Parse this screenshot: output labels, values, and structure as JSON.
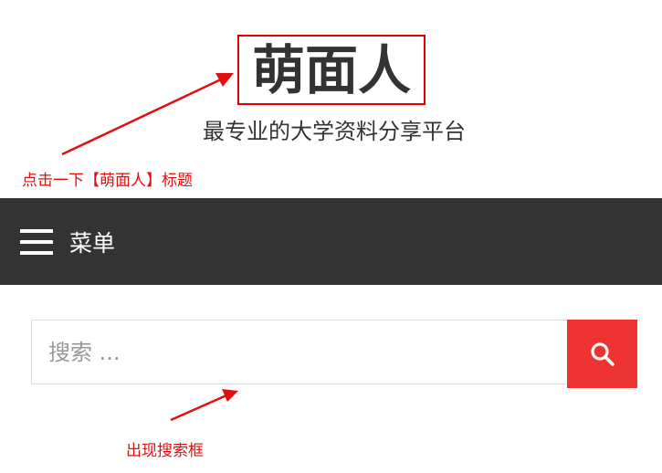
{
  "header": {
    "site_title": "萌面人",
    "tagline": "最专业的大学资料分享平台"
  },
  "annotations": {
    "click_title": "点击一下【萌面人】标题",
    "search_appears": "出现搜索框"
  },
  "nav": {
    "menu_label": "菜单",
    "menu_icon": "hamburger-icon"
  },
  "search": {
    "placeholder": "搜索 ...",
    "value": "",
    "button_icon": "search-icon"
  },
  "colors": {
    "nav_background": "#333333",
    "search_button": "#ee3333",
    "annotation": "#e01010",
    "highlight_box": "#e00000"
  }
}
